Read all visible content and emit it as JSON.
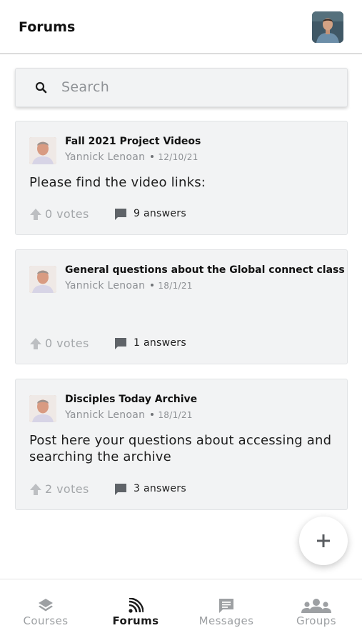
{
  "header": {
    "title": "Forums",
    "avatar_icon": "user-avatar"
  },
  "search": {
    "placeholder": "Search",
    "icon": "search-icon"
  },
  "posts": [
    {
      "title": "Fall 2021 Project Videos",
      "author": "Yannick Lenoan",
      "date": "12/10/21",
      "body": "Please find the video links:",
      "votes": "0 votes",
      "answers": "9 answers"
    },
    {
      "title": "General questions about the Global connect class",
      "author": "Yannick Lenoan",
      "date": "18/1/21",
      "body": "",
      "votes": "0 votes",
      "answers": "1 answers"
    },
    {
      "title": "Disciples Today Archive",
      "author": "Yannick Lenoan",
      "date": "18/1/21",
      "body": "Post here your questions about accessing and searching the archive",
      "votes": "2 votes",
      "answers": "3 answers"
    }
  ],
  "fab": {
    "icon": "plus-icon"
  },
  "bottom_nav": {
    "items": [
      {
        "label": "Courses",
        "icon": "layers-icon",
        "active": false
      },
      {
        "label": "Forums",
        "icon": "forums-icon",
        "active": true
      },
      {
        "label": "Messages",
        "icon": "message-icon",
        "active": false
      },
      {
        "label": "Groups",
        "icon": "groups-icon",
        "active": false
      }
    ]
  },
  "colors": {
    "card_bg": "#f2f3f4",
    "muted_text": "#8e9195",
    "icon_gray": "#5f6368",
    "active_nav": "#1a1a1a"
  }
}
